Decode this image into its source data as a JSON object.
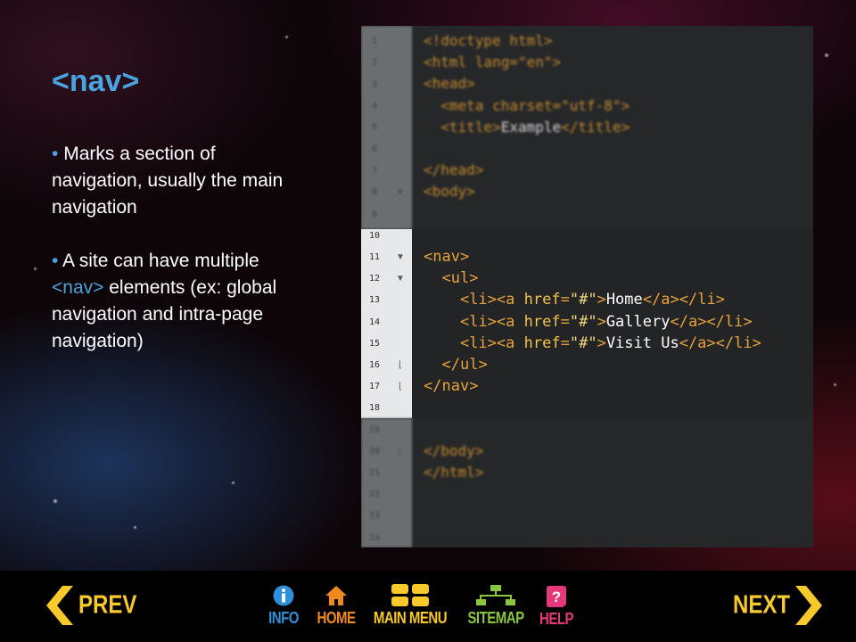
{
  "slide": {
    "title": "<nav>",
    "bullets": [
      {
        "text": "Marks a section of navigation, usually the main navigation"
      },
      {
        "prefix": "A site can have multiple ",
        "highlight": "<nav>",
        "suffix": " elements (ex: global navigation and intra-page navigation)"
      }
    ]
  },
  "editor": {
    "line_numbers": [
      "1",
      "2",
      "3",
      "4",
      "5",
      "6",
      "7",
      "8",
      "9",
      "10",
      "11",
      "12",
      "13",
      "14",
      "15",
      "16",
      "17",
      "18",
      "19",
      "20",
      "21",
      "22",
      "23",
      "24"
    ],
    "focus_lines": [
      10,
      18
    ],
    "lines": [
      "<!doctype html>",
      "<html lang=\"en\">",
      "<head>",
      "  <meta charset=\"utf-8\">",
      "  <title>Example</title>",
      "",
      "</head>",
      "<body>",
      "",
      "",
      "<nav>",
      "  <ul>",
      "    <li><a href=\"#\">Home</a></li>",
      "    <li><a href=\"#\">Gallery</a></li>",
      "    <li><a href=\"#\">Visit Us</a></li>",
      "  </ul>",
      "</nav>",
      "",
      "",
      "</body>",
      "</html>",
      "",
      "",
      ""
    ]
  },
  "nav": {
    "prev_label": "PREV",
    "next_label": "NEXT",
    "items": [
      {
        "label": "INFO",
        "icon": "info-icon",
        "color": "#2f8fd8"
      },
      {
        "label": "HOME",
        "icon": "home-icon",
        "color": "#f08a1e"
      },
      {
        "label": "MAIN MENU",
        "icon": "grid-icon",
        "color": "#f7c92b"
      },
      {
        "label": "SITEMAP",
        "icon": "sitemap-icon",
        "color": "#8cc63f"
      },
      {
        "label": "HELP",
        "icon": "help-icon",
        "color": "#e4387a"
      }
    ]
  },
  "colors": {
    "accent": "#4aa3df",
    "prev_next": "#f7c92b"
  }
}
